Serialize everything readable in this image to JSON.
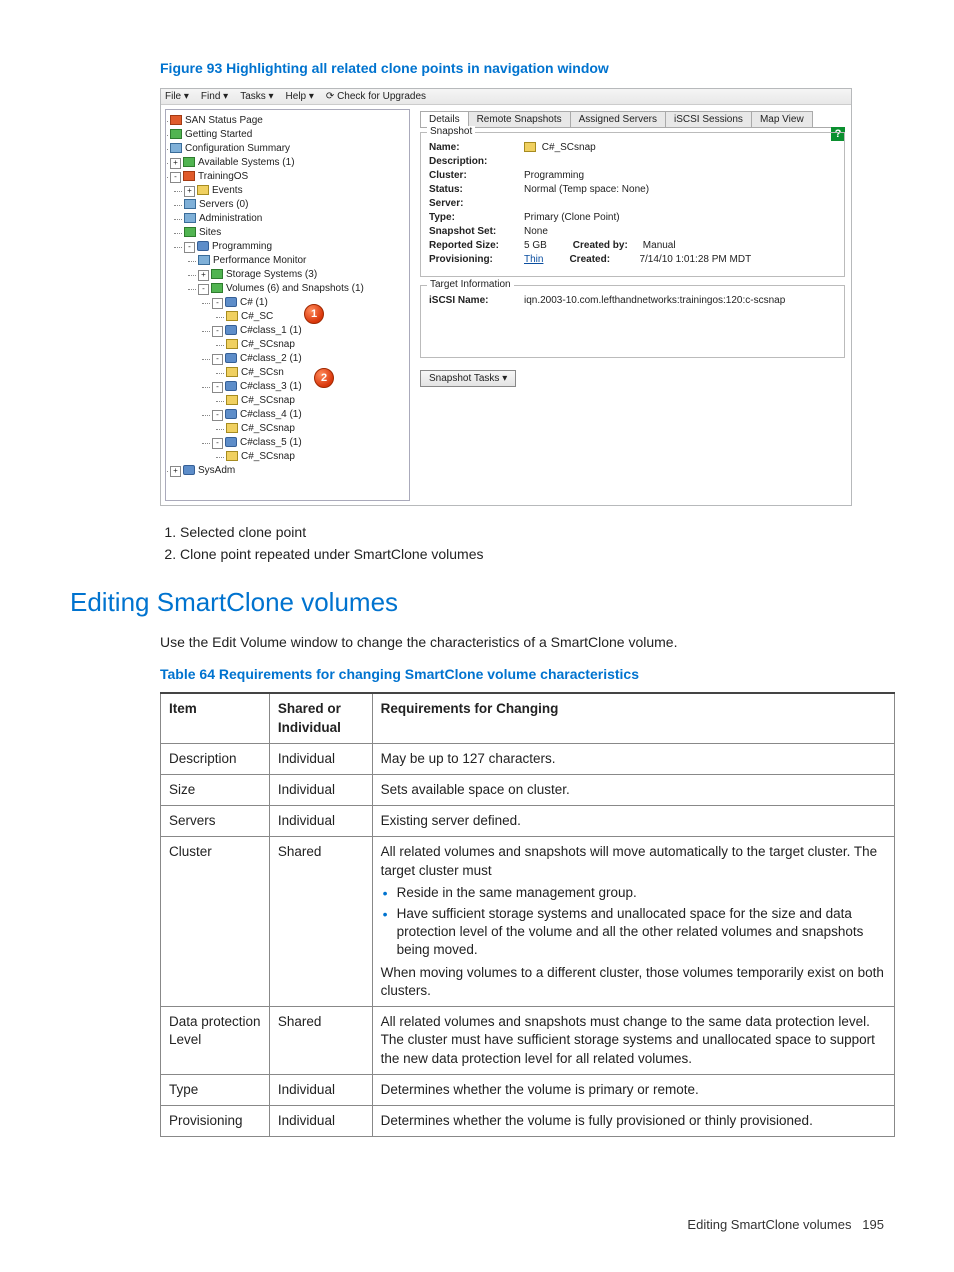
{
  "figure": {
    "title": "Figure 93 Highlighting all related clone points in navigation window",
    "menubar": [
      "File ▾",
      "Find ▾",
      "Tasks ▾",
      "Help ▾",
      "⟳ Check for Upgrades"
    ],
    "tree": {
      "san_status": "SAN Status Page",
      "getting_started": "Getting Started",
      "config_summary": "Configuration Summary",
      "avail_systems": "Available Systems (1)",
      "training": "TrainingOS",
      "events": "Events",
      "servers": "Servers (0)",
      "administration": "Administration",
      "sites": "Sites",
      "programming": "Programming",
      "perf_monitor": "Performance Monitor",
      "storage_systems": "Storage Systems (3)",
      "volumes": "Volumes (6) and Snapshots (1)",
      "c1": "C# (1)",
      "c1s": "C#_SC",
      "cc1": "C#class_1 (1)",
      "scsnap": "C#_SCsnap",
      "cc2": "C#class_2 (1)",
      "scsn": "C#_SCsn",
      "cc3": "C#class_3 (1)",
      "cc4": "C#class_4 (1)",
      "cc5": "C#class_5 (1)",
      "sysadm": "SysAdm"
    },
    "tabs": [
      "Details",
      "Remote Snapshots",
      "Assigned Servers",
      "iSCSI Sessions",
      "Map View"
    ],
    "snapshot_legend": "Snapshot",
    "target_legend": "Target Information",
    "snapshot": {
      "name_k": "Name:",
      "name_v": "C#_SCsnap",
      "desc_k": "Description:",
      "desc_v": "",
      "cluster_k": "Cluster:",
      "cluster_v": "Programming",
      "status_k": "Status:",
      "status_v": "Normal (Temp space: None)",
      "server_k": "Server:",
      "server_v": "",
      "type_k": "Type:",
      "type_v": "Primary (Clone Point)",
      "set_k": "Snapshot Set:",
      "set_v": "None",
      "rsize_k": "Reported Size:",
      "rsize_v": "5 GB",
      "cby_k": "Created by:",
      "cby_v": "Manual",
      "prov_k": "Provisioning:",
      "prov_v": "Thin",
      "created_k": "Created:",
      "created_v": "7/14/10 1:01:28 PM MDT"
    },
    "target": {
      "iscsi_k": "iSCSI Name:",
      "iscsi_v": "iqn.2003-10.com.lefthandnetworks:trainingos:120:c-scsnap"
    },
    "snapshot_tasks_btn": "Snapshot Tasks ▾"
  },
  "notes": {
    "n1": "Selected clone point",
    "n2": "Clone point repeated under SmartClone volumes"
  },
  "section": {
    "heading": "Editing SmartClone volumes",
    "intro": "Use the Edit Volume window to change the characteristics of a SmartClone volume."
  },
  "table": {
    "title": "Table 64 Requirements for changing SmartClone volume characteristics",
    "head": {
      "c1": "Item",
      "c2": "Shared or Individual",
      "c3": "Requirements for Changing"
    },
    "rows": {
      "r1": {
        "c1": "Description",
        "c2": "Individual",
        "c3": "May be up to 127 characters."
      },
      "r2": {
        "c1": "Size",
        "c2": "Individual",
        "c3": "Sets available space on cluster."
      },
      "r3": {
        "c1": "Servers",
        "c2": "Individual",
        "c3": "Existing server defined."
      },
      "r4": {
        "c1": "Cluster",
        "c2": "Shared",
        "intro": "All related volumes and snapshots will move automatically to the target cluster. The target cluster must",
        "b1": "Reside in the same management group.",
        "b2": "Have sufficient storage systems and unallocated space for the size and data protection level of the volume and all the other related volumes and snapshots being moved.",
        "outro": "When moving volumes to a different cluster, those volumes temporarily exist on both clusters."
      },
      "r5": {
        "c1": "Data protection Level",
        "c2": "Shared",
        "c3": "All related volumes and snapshots must change to the same data protection level. The cluster must have sufficient storage systems and unallocated space to support the new data protection level for all related volumes."
      },
      "r6": {
        "c1": "Type",
        "c2": "Individual",
        "c3": "Determines whether the volume is primary or remote."
      },
      "r7": {
        "c1": "Provisioning",
        "c2": "Individual",
        "c3": "Determines whether the volume is fully provisioned or thinly provisioned."
      }
    }
  },
  "footer": {
    "text": "Editing SmartClone volumes",
    "page": "195"
  }
}
